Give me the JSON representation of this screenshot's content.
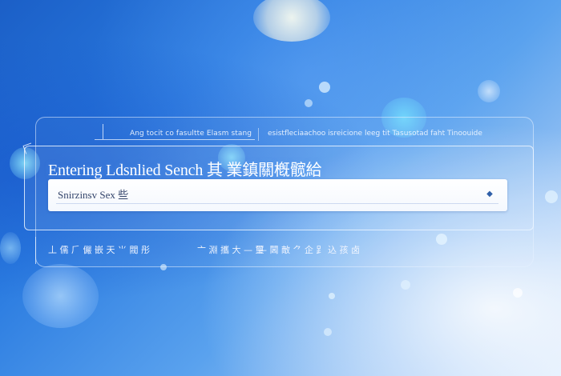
{
  "header": {
    "breadcrumb_left": "Ang tocit co fasultte Elasm stang",
    "breadcrumb_right": "esistfleciaachoo isreicione leeg tit Tasusotad faht Tinoouide"
  },
  "search_panel": {
    "title": "Entering Ldsnlied Sench 其 業鎮關槪髋給",
    "input_value": "Snirzinsv Sex 些",
    "dropdown_icon": "chevron-down-icon"
  },
  "footer": {
    "segment_1": "丄 儒 ⺁ 儼 嵌 天 ⺌ 閥 彤",
    "segment_2": "⼇ 淵 攜 大 — 璽",
    "segment_3": "— 閪 敵 ⺈ 企 ⻊ 込 孩 ⻧"
  }
}
